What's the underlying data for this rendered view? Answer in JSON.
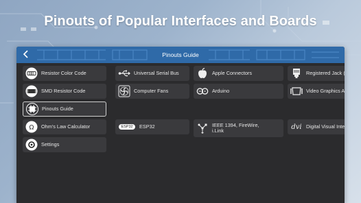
{
  "headline": "Pinouts of Popular Interfaces and Boards",
  "appbar": {
    "title": "Pinouts Guide",
    "back_icon": "chevron-left-icon"
  },
  "sidebar": {
    "items": [
      {
        "label": "Resistor Color Code",
        "icon": "resistor-icon",
        "selected": false
      },
      {
        "label": "SMD Resistor Code",
        "icon": "smd-resistor-icon",
        "selected": false
      },
      {
        "label": "Pinouts Guide",
        "icon": "chip-icon",
        "selected": true
      },
      {
        "label": "Ohm's Law Calculator",
        "icon": "ohm-icon",
        "selected": false
      },
      {
        "label": "Settings",
        "icon": "settings-icon",
        "selected": false
      }
    ]
  },
  "grid": {
    "items": [
      {
        "label": "Universal Serial Bus",
        "icon": "usb-icon"
      },
      {
        "label": "Apple Connectors",
        "icon": "apple-icon"
      },
      {
        "label": "Registered Jack (RJ)",
        "icon": "rj-jack-icon"
      },
      {
        "label": "Computer Fans",
        "icon": "fan-icon"
      },
      {
        "label": "Arduino",
        "icon": "arduino-icon"
      },
      {
        "label": "Video Graphics Array",
        "icon": "vga-icon"
      },
      {
        "label": "ESP32",
        "icon": "esp32-icon",
        "badge": "ESP32"
      },
      {
        "label": "IEEE 1394, FireWire, i.Link",
        "icon": "firewire-icon"
      },
      {
        "label": "Digital Visual Interface",
        "icon": "dvi-icon",
        "badge": "dvi"
      }
    ]
  }
}
